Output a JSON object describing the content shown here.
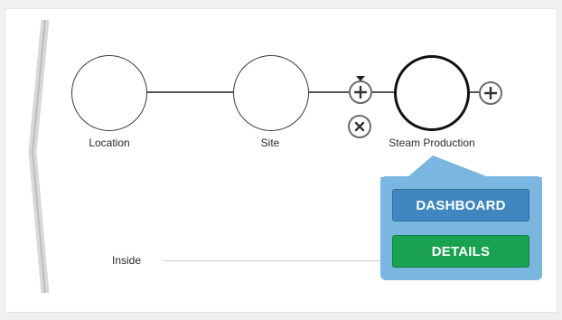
{
  "diagram": {
    "nodes": [
      {
        "id": "location",
        "label": "Location",
        "selected": false
      },
      {
        "id": "site",
        "label": "Site",
        "selected": false
      },
      {
        "id": "steam-production",
        "label": "Steam Production",
        "selected": true
      }
    ],
    "row_label": "Inside"
  },
  "popover": {
    "dashboard_label": "DASHBOARD",
    "details_label": "DETAILS"
  },
  "icons": {
    "back": "chevron-left-icon",
    "add": "plus-icon",
    "remove": "close-icon",
    "pointer": "triangle-down-icon"
  },
  "colors": {
    "popover_bg": "#7ab6e0",
    "dashboard_button": "#3f87be",
    "details_button": "#1aa152"
  }
}
